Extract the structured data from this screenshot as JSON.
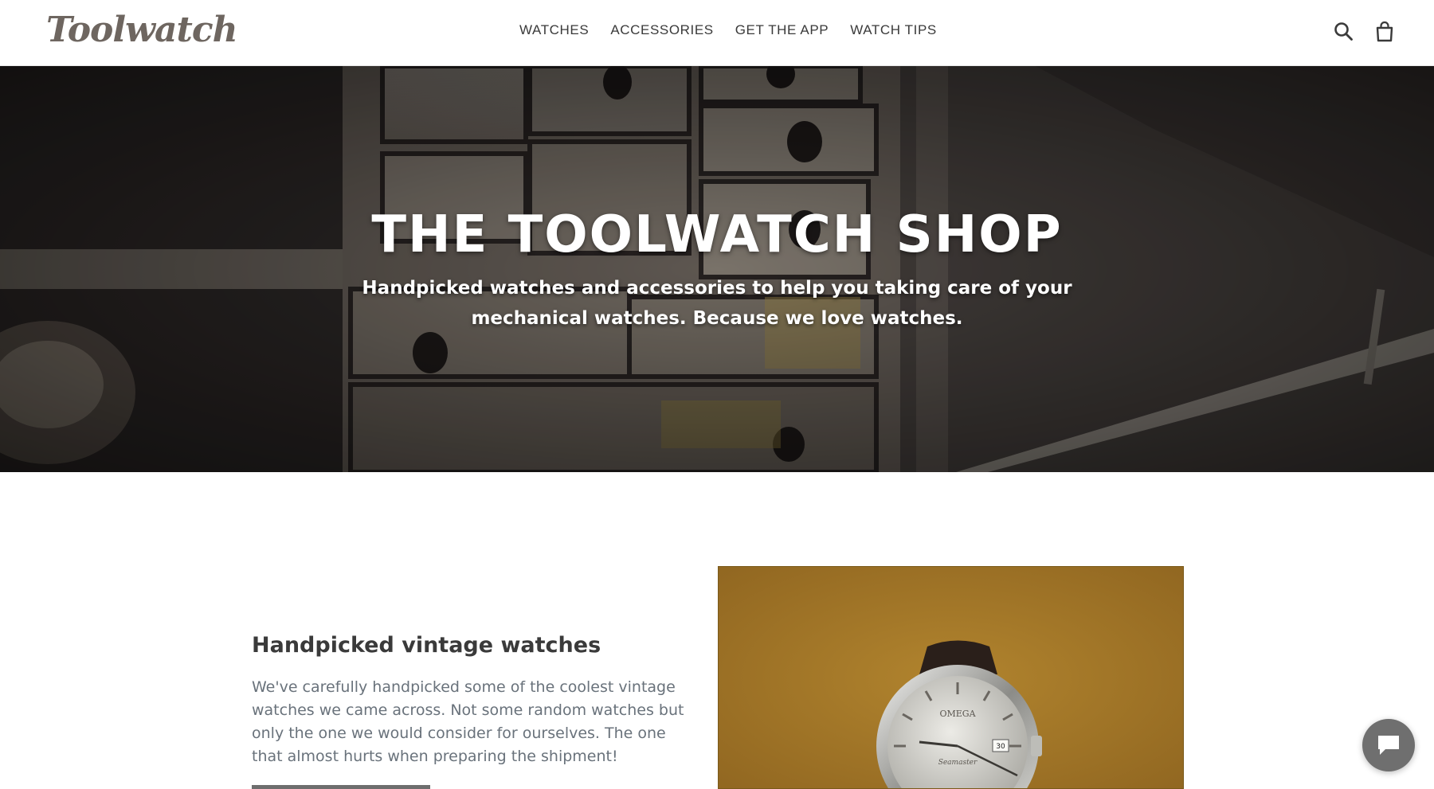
{
  "header": {
    "logo": "Toolwatch",
    "nav": [
      {
        "label": "WATCHES"
      },
      {
        "label": "ACCESSORIES"
      },
      {
        "label": "GET THE APP"
      },
      {
        "label": "WATCH TIPS"
      }
    ],
    "icons": [
      "search-icon",
      "cart-icon"
    ]
  },
  "hero": {
    "title": "THE TOOLWATCH SHOP",
    "subtitle": "Handpicked watches and accessories to help you taking care of your mechanical watches. Because we love watches."
  },
  "feature": {
    "title": "Handpicked vintage watches",
    "text": "We've carefully handpicked some of the coolest vintage watches we came across. Not some random watches but only the one we would consider for ourselves. The one that almost hurts when preparing the shipment!",
    "watch_brand": "OMEGA",
    "watch_model": "Seamaster",
    "watch_date": "30"
  },
  "chat": {
    "icon": "chat-bubble-icon"
  },
  "colors": {
    "logo": "#6e6660",
    "text": "#3a3a3a",
    "muted": "#69727b",
    "feature_bg": "#a97c2a"
  }
}
